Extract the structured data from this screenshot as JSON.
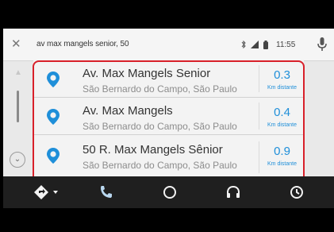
{
  "search": {
    "close_glyph": "✕",
    "query": "av max mangels senior, 50"
  },
  "status": {
    "time": "11:55",
    "icons": [
      "bluetooth-icon",
      "signal-icon",
      "battery-icon"
    ]
  },
  "mic": {
    "icon": "microphone-icon"
  },
  "rail": {
    "up_glyph": "▲",
    "down_glyph": "⌄"
  },
  "results": [
    {
      "title": "Av. Max Mangels Senior",
      "subtitle": "São Bernardo do Campo, São Paulo",
      "distance": "0.3",
      "unit": "Km distante"
    },
    {
      "title": "Av. Max Mangels",
      "subtitle": "São Bernardo do Campo, São Paulo",
      "distance": "0.4",
      "unit": "Km distante"
    },
    {
      "title": "50 R. Max Mangels Sênior",
      "subtitle": "São Bernardo do Campo, São Paulo",
      "distance": "0.9",
      "unit": "Km distante"
    }
  ],
  "nav": {
    "items": [
      "navigation-icon",
      "phone-icon",
      "home-icon",
      "headphones-icon",
      "recent-icon"
    ]
  },
  "colors": {
    "accent": "#1f8fd9",
    "highlight": "#d8202a",
    "navbar": "#1f1f1f"
  }
}
